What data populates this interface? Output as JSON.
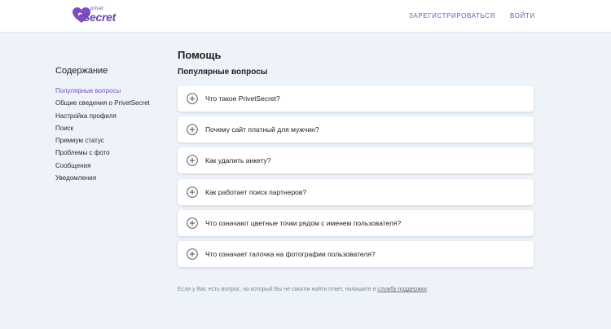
{
  "header": {
    "logo_small": "privet",
    "logo_big": "Secret",
    "register_label": "Зарегистрироваться",
    "login_label": "Войти"
  },
  "sidebar": {
    "title": "Содержание",
    "items": [
      {
        "label": "Популярные вопросы",
        "active": true
      },
      {
        "label": "Общие сведения о PrivetSecret",
        "active": false
      },
      {
        "label": "Настройка профиля",
        "active": false
      },
      {
        "label": "Поиск",
        "active": false
      },
      {
        "label": "Премиум статус",
        "active": false
      },
      {
        "label": "Проблемы с фото",
        "active": false
      },
      {
        "label": "Сообщения",
        "active": false
      },
      {
        "label": "Уведомления",
        "active": false
      }
    ]
  },
  "main": {
    "title": "Помощь",
    "section_title": "Популярные вопросы",
    "faq": [
      {
        "question": "Что такое PrivetSecret?",
        "icon": "plus-circle-icon"
      },
      {
        "question": "Почему сайт платный для мужчин?",
        "icon": "plus-circle-icon"
      },
      {
        "question": "Как удалить анкету?",
        "icon": "plus-circle-icon"
      },
      {
        "question": "Как работает поиск партнеров?",
        "icon": "plus-circle-icon"
      },
      {
        "question": "Что означают цветные точки рядом с именем пользователя?",
        "icon": "plus-circle-icon"
      },
      {
        "question": "Что означает галочка на фотографии пользователя?",
        "icon": "plus-circle-icon"
      }
    ],
    "footer_text": "Если у Вас есть вопрос, на который Вы не смогли найти ответ, напишите в ",
    "footer_link": "службу поддержки",
    "footer_end": "."
  },
  "colors": {
    "accent": "#7b4fc1",
    "background": "#eef3f9",
    "card": "#ffffff"
  }
}
